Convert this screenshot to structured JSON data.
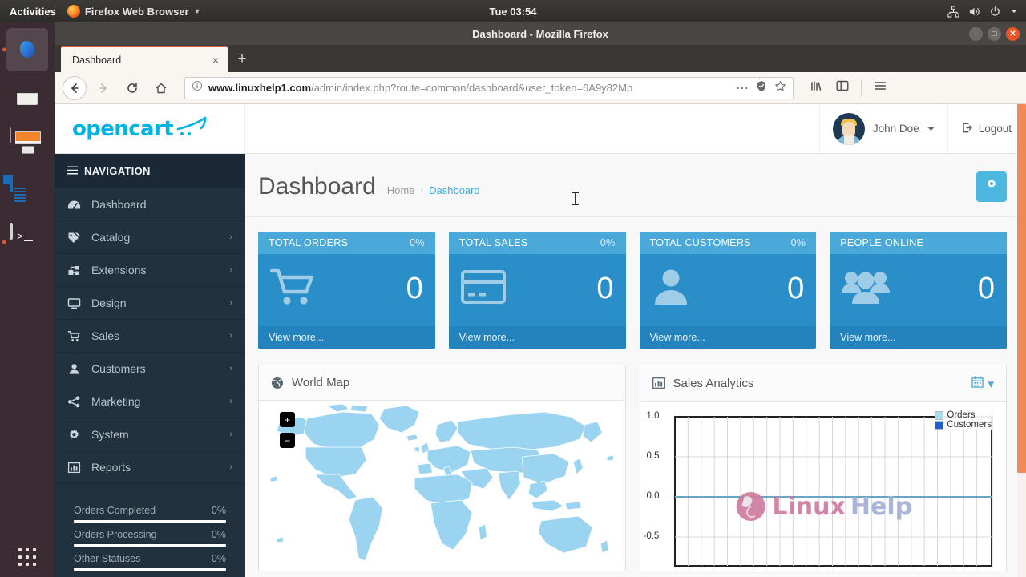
{
  "desktop": {
    "activities_label": "Activities",
    "app_menu_label": "Firefox Web Browser",
    "clock": "Tue 03:54",
    "tray_icons": [
      "network-icon",
      "volume-icon",
      "power-icon",
      "chevron-down-icon"
    ],
    "dock_items": [
      {
        "name": "firefox",
        "label": "Firefox Web Browser",
        "running": true,
        "focused": true
      },
      {
        "name": "thunderbird",
        "label": "Thunderbird Mail",
        "running": false,
        "focused": false
      },
      {
        "name": "files",
        "label": "Files",
        "running": false,
        "focused": false
      },
      {
        "name": "libreoffice-writer",
        "label": "LibreOffice Writer",
        "running": false,
        "focused": false
      },
      {
        "name": "terminal",
        "label": "Terminal",
        "running": true,
        "focused": false
      }
    ],
    "show_applications_label": "Show Applications"
  },
  "browser": {
    "window_title": "Dashboard - Mozilla Firefox",
    "window_buttons": [
      "minimize",
      "maximize",
      "close"
    ],
    "tab": {
      "title": "Dashboard",
      "close_label": "×"
    },
    "new_tab_label": "+",
    "nav": {
      "back": "←",
      "forward": "→",
      "reload": "⟳",
      "home": "⌂"
    },
    "url": {
      "host": "www.linuxhelp1.com",
      "path": "/admin/index.php?route=common/dashboard&user_token=6A9y82Mp",
      "full": "www.linuxhelp1.com/admin/index.php?route=common/dashboard&user_token=6A9y82Mp"
    },
    "url_actions": [
      "page-actions-icon",
      "shield-icon",
      "bookmark-star-icon"
    ],
    "toolbar_right": [
      "library-icon",
      "sidebar-icon",
      "hamburger-menu-icon"
    ]
  },
  "app": {
    "logo_text": "opencart",
    "user_name": "John Doe",
    "logout_label": "Logout",
    "nav_heading": "NAVIGATION",
    "nav_items": [
      {
        "label": "Dashboard",
        "icon": "dashboard-icon",
        "caret": ""
      },
      {
        "label": "Catalog",
        "icon": "tag-icon",
        "caret": "›"
      },
      {
        "label": "Extensions",
        "icon": "puzzle-icon",
        "caret": "›"
      },
      {
        "label": "Design",
        "icon": "monitor-icon",
        "caret": "›"
      },
      {
        "label": "Sales",
        "icon": "cart-icon",
        "caret": "›"
      },
      {
        "label": "Customers",
        "icon": "user-icon",
        "caret": "›"
      },
      {
        "label": "Marketing",
        "icon": "share-icon",
        "caret": "›"
      },
      {
        "label": "System",
        "icon": "gear-icon",
        "caret": "›"
      },
      {
        "label": "Reports",
        "icon": "bar-chart-icon",
        "caret": "›"
      }
    ],
    "nav_stats": [
      {
        "label": "Orders Completed",
        "value": "0%"
      },
      {
        "label": "Orders Processing",
        "value": "0%"
      },
      {
        "label": "Other Statuses",
        "value": "0%"
      }
    ],
    "page_title": "Dashboard",
    "breadcrumb": [
      {
        "label": "Home",
        "current": false
      },
      {
        "label": "Dashboard",
        "current": true
      }
    ],
    "breadcrumb_separator": "›",
    "settings_button_icon": "gear-icon",
    "tiles": [
      {
        "title": "TOTAL ORDERS",
        "percent": "0%",
        "value": "0",
        "footer": "View more...",
        "icon": "shopping-cart-icon"
      },
      {
        "title": "TOTAL SALES",
        "percent": "0%",
        "value": "0",
        "footer": "View more...",
        "icon": "credit-card-icon"
      },
      {
        "title": "TOTAL CUSTOMERS",
        "percent": "0%",
        "value": "0",
        "footer": "View more...",
        "icon": "person-icon"
      },
      {
        "title": "PEOPLE ONLINE",
        "percent": "",
        "value": "0",
        "footer": "View more...",
        "icon": "group-icon"
      }
    ],
    "map_panel": {
      "title": "World Map",
      "icon": "globe-icon",
      "zoom_in": "+",
      "zoom_out": "−"
    },
    "chart_panel": {
      "title": "Sales Analytics",
      "icon": "bar-chart-icon",
      "range_icon": "calendar-icon",
      "range_caret": "▾"
    },
    "watermark": {
      "left": "Linux",
      "right": "Help"
    },
    "colors": {
      "brand_blue": "#00b3e3",
      "tile_blue": "#2a8fc9",
      "tile_head_blue": "#4aa9d9",
      "tile_foot_blue": "#2482bc",
      "sidebar_dark": "#21313d",
      "accent_link": "#3aafe0",
      "scrollbar_orange": "#ee8a5a"
    }
  },
  "chart_data": {
    "type": "line",
    "title": "Sales Analytics",
    "xlabel": "",
    "ylabel": "",
    "ylim": [
      -0.75,
      1.0
    ],
    "yticks": [
      "1.0",
      "0.5",
      "0.0",
      "-0.5"
    ],
    "ytick_values": [
      1.0,
      0.5,
      0.0,
      -0.5
    ],
    "xticks": [],
    "grid": true,
    "legend_position": "top-right",
    "series": [
      {
        "name": "Orders",
        "color": "#a6dcef",
        "values": [
          0,
          0,
          0,
          0,
          0,
          0,
          0,
          0,
          0,
          0,
          0,
          0,
          0,
          0,
          0,
          0,
          0,
          0,
          0,
          0,
          0,
          0,
          0,
          0
        ]
      },
      {
        "name": "Customers",
        "color": "#1f5fd6",
        "values": [
          0,
          0,
          0,
          0,
          0,
          0,
          0,
          0,
          0,
          0,
          0,
          0,
          0,
          0,
          0,
          0,
          0,
          0,
          0,
          0,
          0,
          0,
          0,
          0
        ]
      }
    ]
  }
}
